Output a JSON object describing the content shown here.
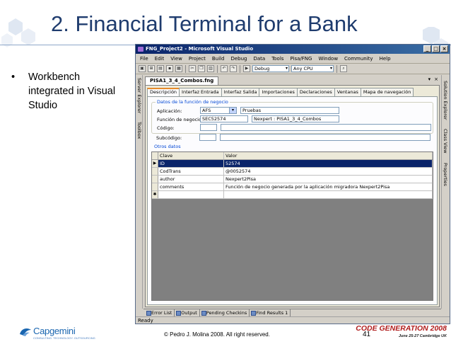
{
  "slide": {
    "title": "2. Financial Terminal for a Bank",
    "bullet_marker": "•",
    "bullet": "Workbench integrated in Visual Studio",
    "copyright": "© Pedro J. Molina 2008. All right reserved.",
    "page_number": "41",
    "capgemini_name": "Capgemini",
    "capgemini_tagline": "CONSULTING. TECHNOLOGY. OUTSOURCING",
    "cg_name": "CODE GENERATION 2008",
    "cg_date": "June 25-27 Cambridge UK"
  },
  "window": {
    "title": "FNG_Project2 - Microsoft Visual Studio",
    "controls": {
      "minimize": "_",
      "maximize": "□",
      "close": "×"
    },
    "menu": [
      "File",
      "Edit",
      "View",
      "Project",
      "Build",
      "Debug",
      "Data",
      "Tools",
      "Pisa/FNG",
      "Window",
      "Community",
      "Help"
    ],
    "toolbar": {
      "config": "Debug",
      "platform": "Any CPU"
    },
    "left_panels": [
      "Server Explorer",
      "Toolbox"
    ],
    "right_panels": [
      "Solution Explorer",
      "Class View",
      "Properties"
    ],
    "status": "Ready"
  },
  "document": {
    "tab": "PISA1_3_4_Combos.fng",
    "doc_controls": {
      "dropdown": "▾",
      "close": "×"
    },
    "subtabs": [
      "Descripción",
      "Interfaz Entrada",
      "Interfaz Salida",
      "Importaciones",
      "Declaraciones",
      "Ventanas",
      "Mapa de navegación"
    ],
    "group_title": "Datos de la función de negocio",
    "fields": {
      "aplicacion_label": "Aplicación:",
      "aplicacion_value": "AFS",
      "aplicacion_desc": "Pruebas",
      "funcion_label": "Función de negocio:",
      "funcion_value": "SEC52574",
      "funcion_desc": "Nexpert : PISA1_3_4_Combos",
      "codigo_label": "Código:",
      "subcodigo_label": "Subcódigo:"
    },
    "otros_title": "Otros datos",
    "grid": {
      "columns": [
        "Clave",
        "Valor"
      ],
      "rows": [
        {
          "marker": "▶",
          "key": "ID",
          "value": "52574"
        },
        {
          "marker": "",
          "key": "CodTrans",
          "value": "@0052574"
        },
        {
          "marker": "",
          "key": "author",
          "value": "Nexpert2Pisa"
        },
        {
          "marker": "",
          "key": "comments",
          "value": "Función de negocio generada por la aplicación migradora Nexpert2Pisa"
        },
        {
          "marker": "✱",
          "key": "",
          "value": ""
        }
      ]
    }
  },
  "bottom_tabs": [
    "Error List",
    "Output",
    "Pending Checkins",
    "Find Results 1"
  ],
  "colors": {
    "title_blue": "#1f3c6e",
    "titlebar_start": "#0a246a",
    "titlebar_end": "#3a6ea5",
    "selected_row": "#0a246a",
    "active_tab_accent": "#e68b2c"
  }
}
